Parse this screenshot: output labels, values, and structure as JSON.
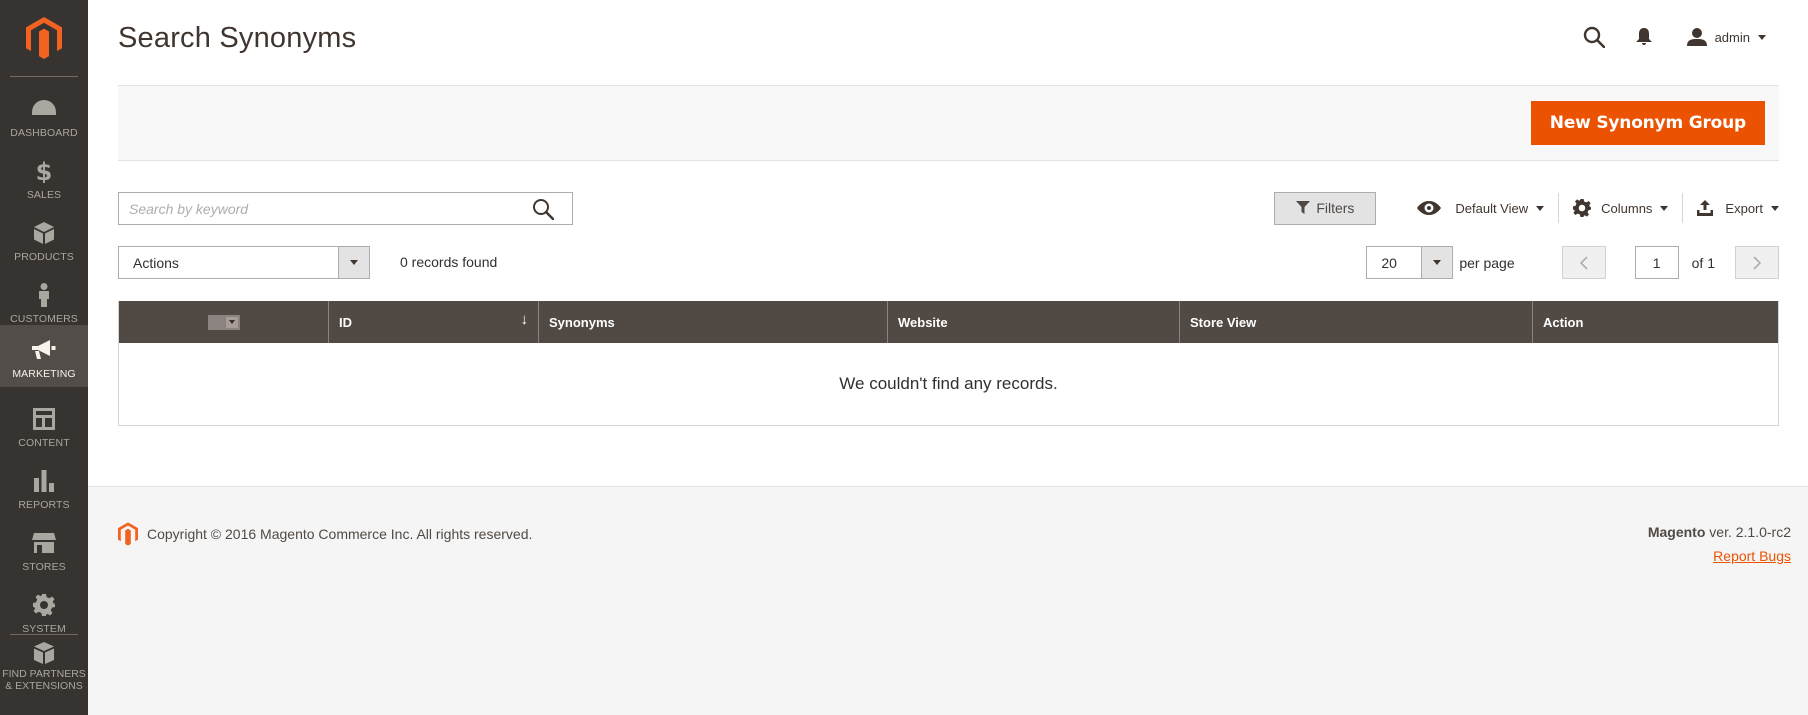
{
  "sidebar": {
    "logo_icon": "magento-logo-icon",
    "items": [
      {
        "label": "DASHBOARD",
        "icon": "dashboard-icon"
      },
      {
        "label": "SALES",
        "icon": "dollar-icon"
      },
      {
        "label": "PRODUCTS",
        "icon": "cube-icon"
      },
      {
        "label": "CUSTOMERS",
        "icon": "person-icon"
      },
      {
        "label": "MARKETING",
        "icon": "megaphone-icon",
        "active": true
      },
      {
        "label": "CONTENT",
        "icon": "layout-icon"
      },
      {
        "label": "REPORTS",
        "icon": "bar-chart-icon"
      },
      {
        "label": "STORES",
        "icon": "storefront-icon"
      },
      {
        "label": "SYSTEM",
        "icon": "gear-icon"
      }
    ],
    "partners": {
      "line1": "FIND PARTNERS",
      "line2": "& EXTENSIONS",
      "icon": "boxes-icon"
    }
  },
  "header": {
    "title": "Search Synonyms",
    "user": "admin"
  },
  "page_actions": {
    "new_button": "New Synonym Group"
  },
  "search": {
    "placeholder": "Search by keyword",
    "value": ""
  },
  "toolbar": {
    "filters": "Filters",
    "default_view": "Default View",
    "columns": "Columns",
    "export": "Export"
  },
  "mass_actions": {
    "selected": "Actions"
  },
  "records_found": "0 records found",
  "pager": {
    "per_page_value": "20",
    "per_page_label": "per page",
    "current_page": "1",
    "of_label": "of 1"
  },
  "grid": {
    "columns": [
      "ID",
      "Synonyms",
      "Website",
      "Store View",
      "Action"
    ],
    "empty_message": "We couldn't find any records.",
    "sort_indicator": "↓"
  },
  "footer": {
    "copyright": "Copyright © 2016 Magento Commerce Inc. All rights reserved.",
    "brand": "Magento",
    "version": " ver. 2.1.0-rc2",
    "report_bugs": "Report Bugs"
  },
  "colors": {
    "accent": "#eb5202",
    "sidebar_bg": "#373330",
    "grid_header_bg": "#514943"
  }
}
